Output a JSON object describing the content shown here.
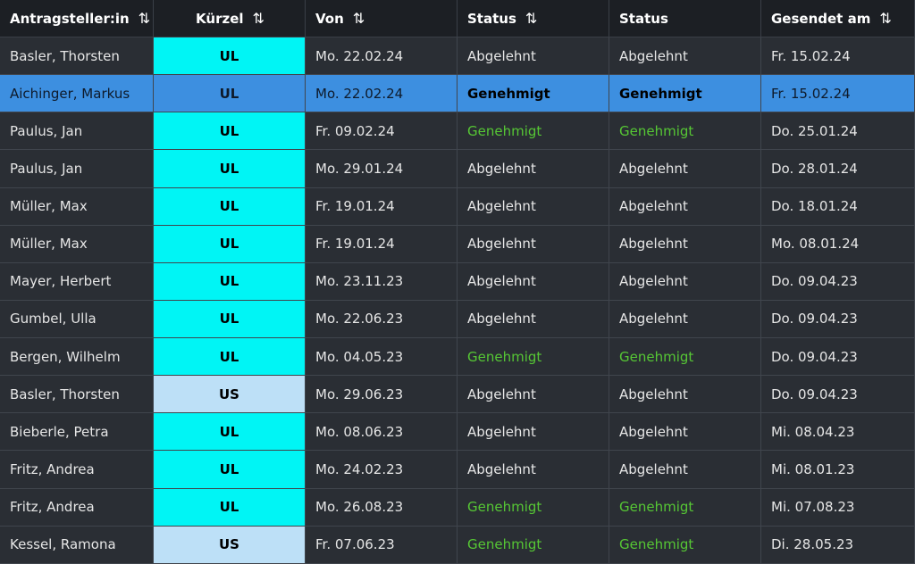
{
  "columns": [
    {
      "label": "Antragsteller:in",
      "sortable": true
    },
    {
      "label": "Kürzel",
      "sortable": true
    },
    {
      "label": "Von",
      "sortable": true
    },
    {
      "label": "Status",
      "sortable": true
    },
    {
      "label": "Status",
      "sortable": false
    },
    {
      "label": "Gesendet am",
      "sortable": true
    }
  ],
  "sort_icon": "⇅",
  "selected_row": 1,
  "colors": {
    "kuerzel_UL": "#00f5f5",
    "kuerzel_US": "#bde0f7",
    "approved": "#56c734",
    "selected": "#3d8fe0"
  },
  "rows": [
    {
      "name": "Basler, Thorsten",
      "kuerzel": "UL",
      "von": "Mo. 22.02.24",
      "status1": "Abgelehnt",
      "status2": "Abgelehnt",
      "gesendet": "Fr. 15.02.24"
    },
    {
      "name": "Aichinger, Markus",
      "kuerzel": "UL",
      "von": "Mo. 22.02.24",
      "status1": "Genehmigt",
      "status2": "Genehmigt",
      "gesendet": "Fr. 15.02.24"
    },
    {
      "name": "Paulus, Jan",
      "kuerzel": "UL",
      "von": "Fr. 09.02.24",
      "status1": "Genehmigt",
      "status2": "Genehmigt",
      "gesendet": "Do. 25.01.24"
    },
    {
      "name": "Paulus, Jan",
      "kuerzel": "UL",
      "von": "Mo. 29.01.24",
      "status1": "Abgelehnt",
      "status2": "Abgelehnt",
      "gesendet": "Do. 28.01.24"
    },
    {
      "name": "Müller, Max",
      "kuerzel": "UL",
      "von": "Fr. 19.01.24",
      "status1": "Abgelehnt",
      "status2": "Abgelehnt",
      "gesendet": "Do. 18.01.24"
    },
    {
      "name": "Müller, Max",
      "kuerzel": "UL",
      "von": "Fr. 19.01.24",
      "status1": "Abgelehnt",
      "status2": "Abgelehnt",
      "gesendet": "Mo. 08.01.24"
    },
    {
      "name": "Mayer, Herbert",
      "kuerzel": "UL",
      "von": "Mo. 23.11.23",
      "status1": "Abgelehnt",
      "status2": "Abgelehnt",
      "gesendet": "Do. 09.04.23"
    },
    {
      "name": "Gumbel, Ulla",
      "kuerzel": "UL",
      "von": "Mo. 22.06.23",
      "status1": "Abgelehnt",
      "status2": "Abgelehnt",
      "gesendet": "Do. 09.04.23"
    },
    {
      "name": "Bergen, Wilhelm",
      "kuerzel": "UL",
      "von": "Mo. 04.05.23",
      "status1": "Genehmigt",
      "status2": "Genehmigt",
      "gesendet": "Do. 09.04.23"
    },
    {
      "name": "Basler, Thorsten",
      "kuerzel": "US",
      "von": "Mo. 29.06.23",
      "status1": "Abgelehnt",
      "status2": "Abgelehnt",
      "gesendet": "Do. 09.04.23"
    },
    {
      "name": "Bieberle, Petra",
      "kuerzel": "UL",
      "von": "Mo. 08.06.23",
      "status1": "Abgelehnt",
      "status2": "Abgelehnt",
      "gesendet": "Mi. 08.04.23"
    },
    {
      "name": "Fritz, Andrea",
      "kuerzel": "UL",
      "von": "Mo. 24.02.23",
      "status1": "Abgelehnt",
      "status2": "Abgelehnt",
      "gesendet": "Mi. 08.01.23"
    },
    {
      "name": "Fritz, Andrea",
      "kuerzel": "UL",
      "von": "Mo. 26.08.23",
      "status1": "Genehmigt",
      "status2": "Genehmigt",
      "gesendet": "Mi. 07.08.23"
    },
    {
      "name": "Kessel, Ramona",
      "kuerzel": "US",
      "von": "Fr. 07.06.23",
      "status1": "Genehmigt",
      "status2": "Genehmigt",
      "gesendet": "Di. 28.05.23"
    }
  ]
}
